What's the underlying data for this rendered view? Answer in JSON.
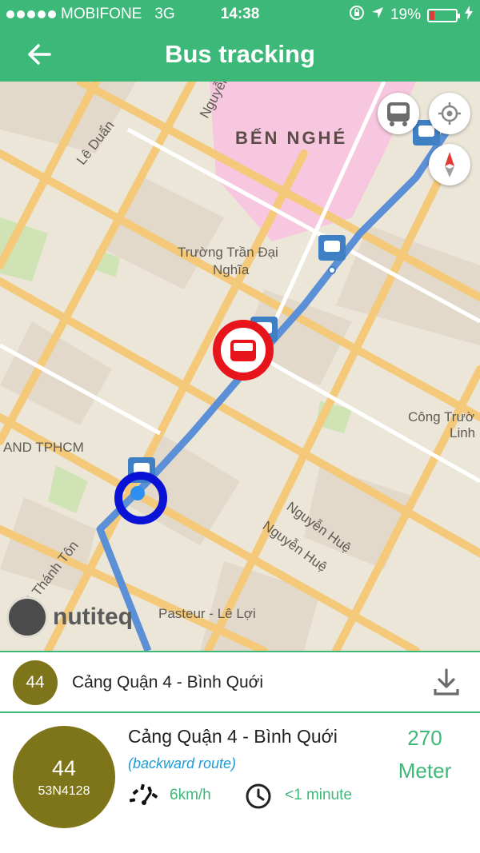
{
  "status_bar": {
    "carrier": "MOBIFONE",
    "network": "3G",
    "time": "14:38",
    "battery_percent": "19%",
    "battery_level": 0.19
  },
  "header": {
    "title": "Bus tracking",
    "back_icon": "arrow-left-icon"
  },
  "map": {
    "district_label": "BẾN NGHÉ",
    "place_labels": {
      "school": "Trường Trần Đại",
      "school_line2": "Nghĩa",
      "park": "Công Trườ",
      "park_line2": "Linh",
      "left_place": "AND TPHCM",
      "street_nguyen_du": "Nguyễn Du",
      "street_le_duan": "Lê Duẩn",
      "street_nguyen_hue_1": "Nguyễn Huệ",
      "street_nguyen_hue_2": "Nguyễn Huệ",
      "street_thanh_ton": "Thánh Tôn",
      "street_ton": "Tôn",
      "street_le_thanh": "Lê Thánh Tôn",
      "pasteur": "Pasteur - Lê Lợi"
    },
    "attribution": "nutiteq",
    "controls": [
      "bus-filter-icon",
      "locate-icon",
      "compass-icon"
    ],
    "colors": {
      "route": "#5b8fd6",
      "current_bus_ring": "#e8141c",
      "user_ring": "#0a12d6",
      "stop": "#3f7fc4",
      "district_fill": "#f6c7de"
    }
  },
  "route_bar": {
    "route_number": "44",
    "route_name": "Cảng Quận 4 - Bình Quới",
    "download_icon": "download-icon"
  },
  "bus_detail": {
    "route_number": "44",
    "plate": "53N4128",
    "route_name": "Cảng Quận 4 - Bình Quới",
    "direction": "(backward route)",
    "speed": "6km/h",
    "speed_icon": "speedometer-icon",
    "eta": "<1 minute",
    "clock_icon": "clock-icon",
    "distance_value": "270",
    "distance_unit": "Meter"
  },
  "colors": {
    "primary": "#3cb878",
    "badge": "#7e7419",
    "direction_text": "#1e9bd7"
  }
}
